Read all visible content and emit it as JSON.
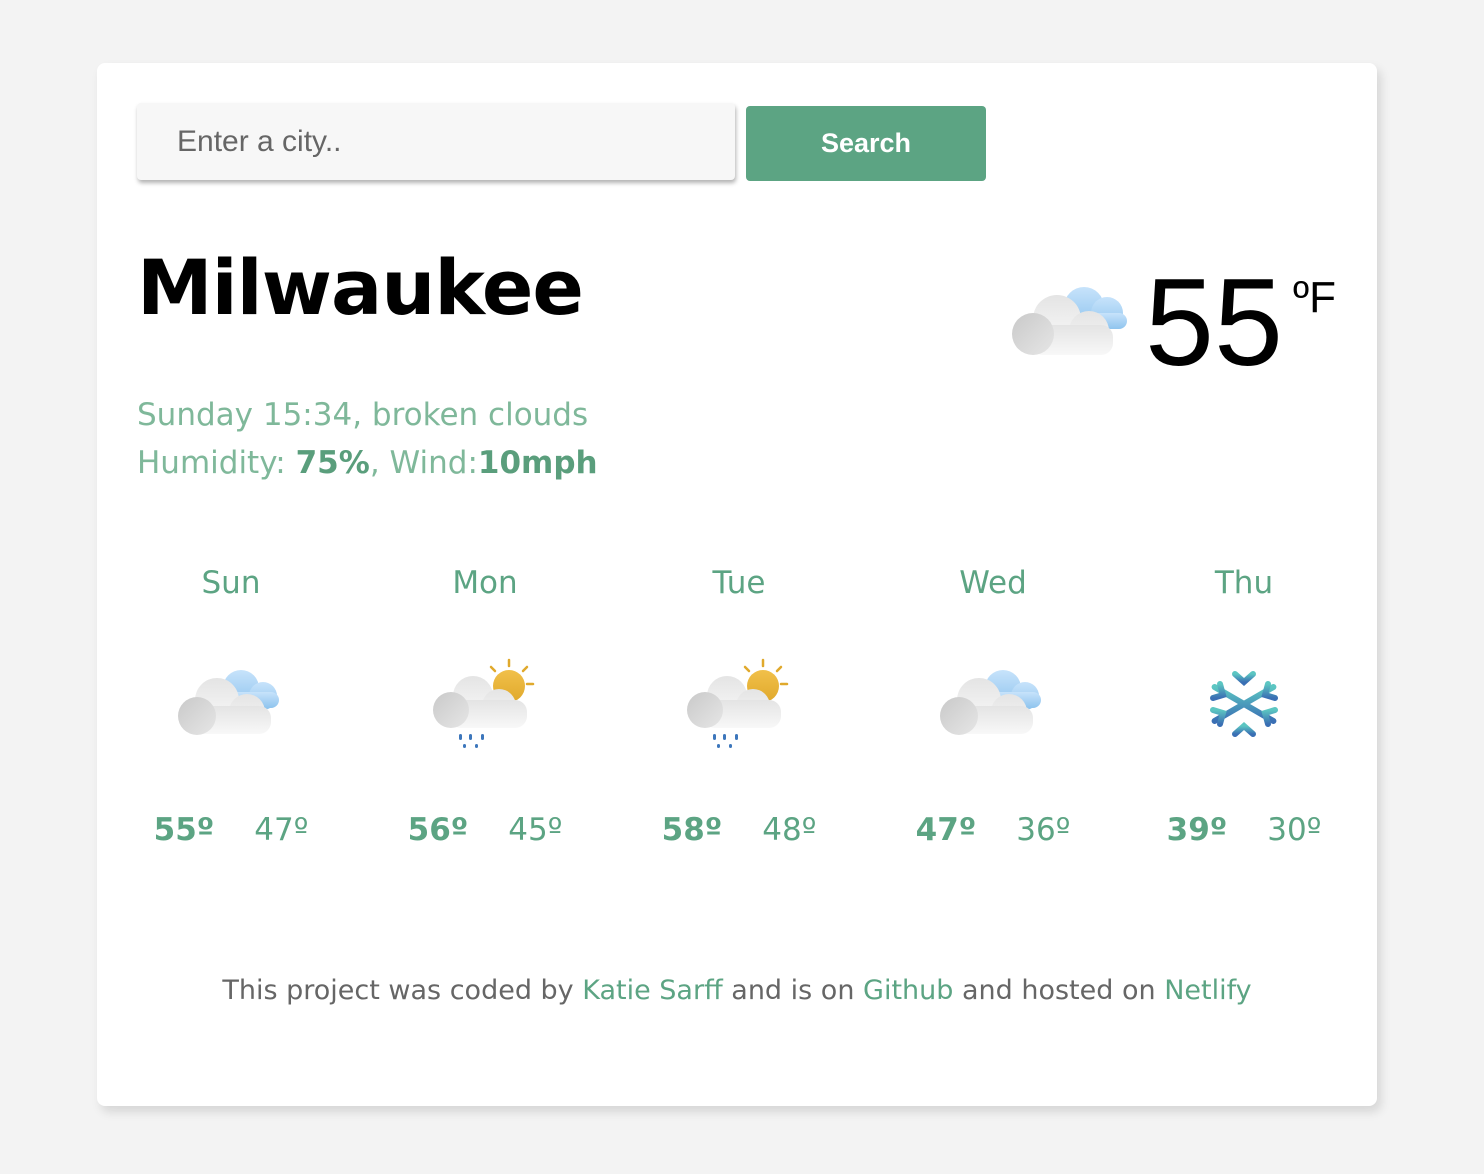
{
  "search": {
    "placeholder": "Enter a city..",
    "value": "",
    "button_label": "Search"
  },
  "current": {
    "city": "Milwaukee",
    "day_time": "Sunday 15:34",
    "description": "broken clouds",
    "humidity_label": "Humidity:",
    "humidity": "75%",
    "wind_label": "Wind:",
    "wind": "10mph",
    "temperature": "55",
    "unit": "ºF",
    "icon": "broken-clouds-icon"
  },
  "forecast": [
    {
      "day": "Sun",
      "max": "55º",
      "min": "47º",
      "icon": "clouds-icon"
    },
    {
      "day": "Mon",
      "max": "56º",
      "min": "45º",
      "icon": "rain-sun-icon"
    },
    {
      "day": "Tue",
      "max": "58º",
      "min": "48º",
      "icon": "rain-sun-icon"
    },
    {
      "day": "Wed",
      "max": "47º",
      "min": "36º",
      "icon": "clouds-icon"
    },
    {
      "day": "Thu",
      "max": "39º",
      "min": "30º",
      "icon": "snowflake-icon"
    }
  ],
  "footer": {
    "text1": "This project was coded by ",
    "author": "Katie Sarff",
    "text2": " and is on ",
    "github": "Github",
    "text3": " and hosted on ",
    "netlify": "Netlify"
  },
  "colors": {
    "accent": "#5ca483",
    "details_text": "#7fb89a",
    "background": "#f3f3f3",
    "card": "#ffffff"
  }
}
